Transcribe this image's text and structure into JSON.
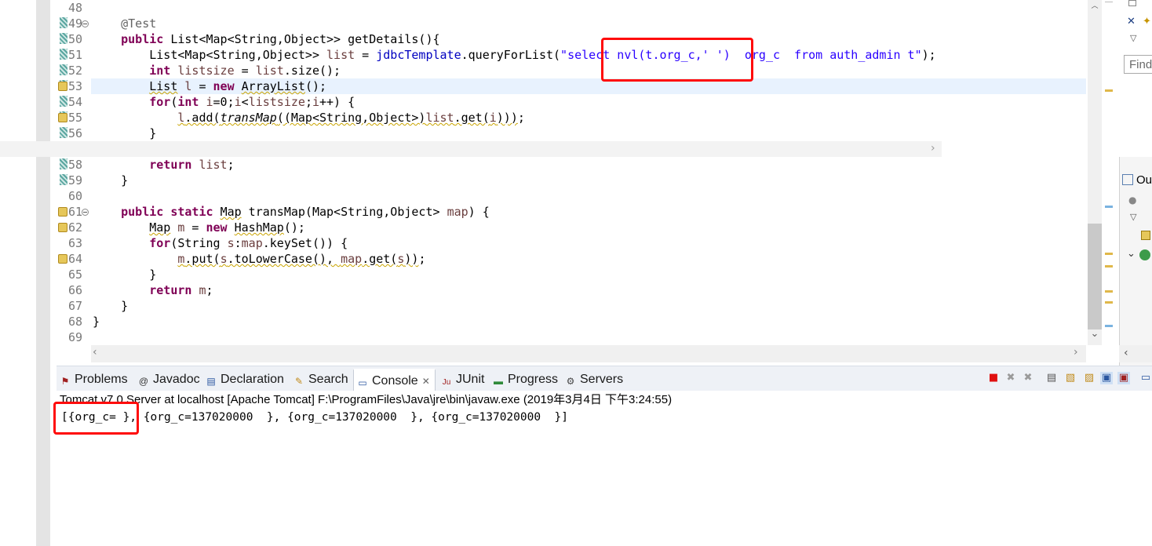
{
  "editor": {
    "lines": [
      {
        "num": "48",
        "text": ""
      },
      {
        "num": "49",
        "text": "    @Test"
      },
      {
        "num": "50",
        "text": "    public List<Map<String,Object>> getDetails(){"
      },
      {
        "num": "51",
        "text": "        List<Map<String,Object>> list = jdbcTemplate.queryForList(\"select nvl(t.org_c,' ')  org_c  from auth_admin t\");"
      },
      {
        "num": "52",
        "text": "        int listsize = list.size();"
      },
      {
        "num": "53",
        "text": "        List l = new ArrayList();"
      },
      {
        "num": "54",
        "text": "        for(int i=0;i<listsize;i++) {"
      },
      {
        "num": "55",
        "text": "            l.add(transMap((Map<String,Object>)list.get(i)));"
      },
      {
        "num": "56",
        "text": "        }"
      },
      {
        "num": "58",
        "text": "        return list;"
      },
      {
        "num": "59",
        "text": "    }"
      },
      {
        "num": "60",
        "text": ""
      },
      {
        "num": "61",
        "text": "    public static Map transMap(Map<String,Object> map) {"
      },
      {
        "num": "62",
        "text": "        Map m = new HashMap();"
      },
      {
        "num": "63",
        "text": "        for(String s:map.keySet()) {"
      },
      {
        "num": "64",
        "text": "            m.put(s.toLowerCase(), map.get(s));"
      },
      {
        "num": "65",
        "text": "        }"
      },
      {
        "num": "66",
        "text": "        return m;"
      },
      {
        "num": "67",
        "text": "    }"
      },
      {
        "num": "68",
        "text": "}"
      },
      {
        "num": "69",
        "text": ""
      }
    ],
    "highlighted_line": "53"
  },
  "bottom_panel": {
    "tabs": [
      {
        "label": "Problems",
        "icon": "problems-icon"
      },
      {
        "label": "Javadoc",
        "icon": "javadoc-icon"
      },
      {
        "label": "Declaration",
        "icon": "declaration-icon"
      },
      {
        "label": "Search",
        "icon": "search-icon"
      },
      {
        "label": "Console",
        "icon": "console-icon",
        "active": true
      },
      {
        "label": "JUnit",
        "icon": "junit-icon"
      },
      {
        "label": "Progress",
        "icon": "progress-icon"
      },
      {
        "label": "Servers",
        "icon": "servers-icon"
      }
    ],
    "close_glyph": "✕",
    "console_title": "Tomcat v7.0 Server at localhost [Apache Tomcat] F:\\ProgramFiles\\Java\\jre\\bin\\javaw.exe (2019年3月4日 下午3:24:55)",
    "console_output": "[{org_c= }, {org_c=137020000  }, {org_c=137020000  }, {org_c=137020000  }]"
  },
  "right_panel": {
    "find_placeholder": "Find",
    "outline_label": "Ou"
  },
  "colors": {
    "keyword": "#7f0055",
    "string": "#2a00ff",
    "field": "#0000c0",
    "annotation_box": "#ff0a0a",
    "line_highlight": "#e8f2fe"
  }
}
